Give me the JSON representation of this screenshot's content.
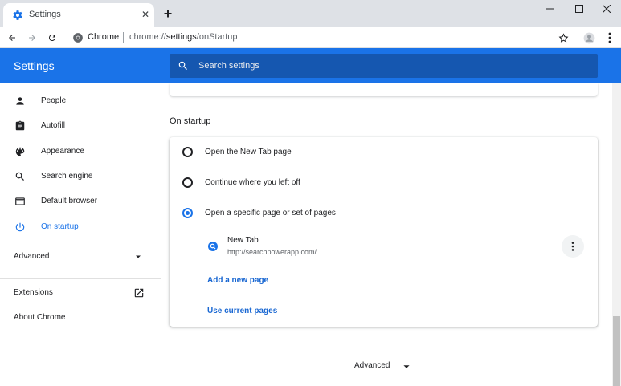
{
  "tab": {
    "title": "Settings",
    "close_glyph": "✕",
    "new_tab_glyph": "+"
  },
  "window_controls": {
    "minimize": "—",
    "maximize": "☐",
    "close": "✕"
  },
  "toolbar": {
    "site_name": "Chrome",
    "url_prefix": "chrome://",
    "url_host": "settings",
    "url_path": "/onStartup"
  },
  "header": {
    "title": "Settings",
    "search_placeholder": "Search settings"
  },
  "sidebar": {
    "items": [
      {
        "label": "People",
        "icon": "person-icon"
      },
      {
        "label": "Autofill",
        "icon": "clipboard-icon"
      },
      {
        "label": "Appearance",
        "icon": "palette-icon"
      },
      {
        "label": "Search engine",
        "icon": "search-icon"
      },
      {
        "label": "Default browser",
        "icon": "browser-icon"
      },
      {
        "label": "On startup",
        "icon": "power-icon",
        "active": true
      }
    ],
    "advanced": "Advanced",
    "extensions": "Extensions",
    "about": "About Chrome"
  },
  "main": {
    "section_title": "On startup",
    "options": [
      {
        "label": "Open the New Tab page",
        "checked": false
      },
      {
        "label": "Continue where you left off",
        "checked": false
      },
      {
        "label": "Open a specific page or set of pages",
        "checked": true
      }
    ],
    "page": {
      "title": "New Tab",
      "url": "http://searchpowerapp.com/"
    },
    "add_page": "Add a new page",
    "use_current": "Use current pages",
    "advanced": "Advanced"
  },
  "colors": {
    "accent": "#1a73e8",
    "header_bg": "#1a73e8",
    "search_bg": "#1557b0"
  }
}
